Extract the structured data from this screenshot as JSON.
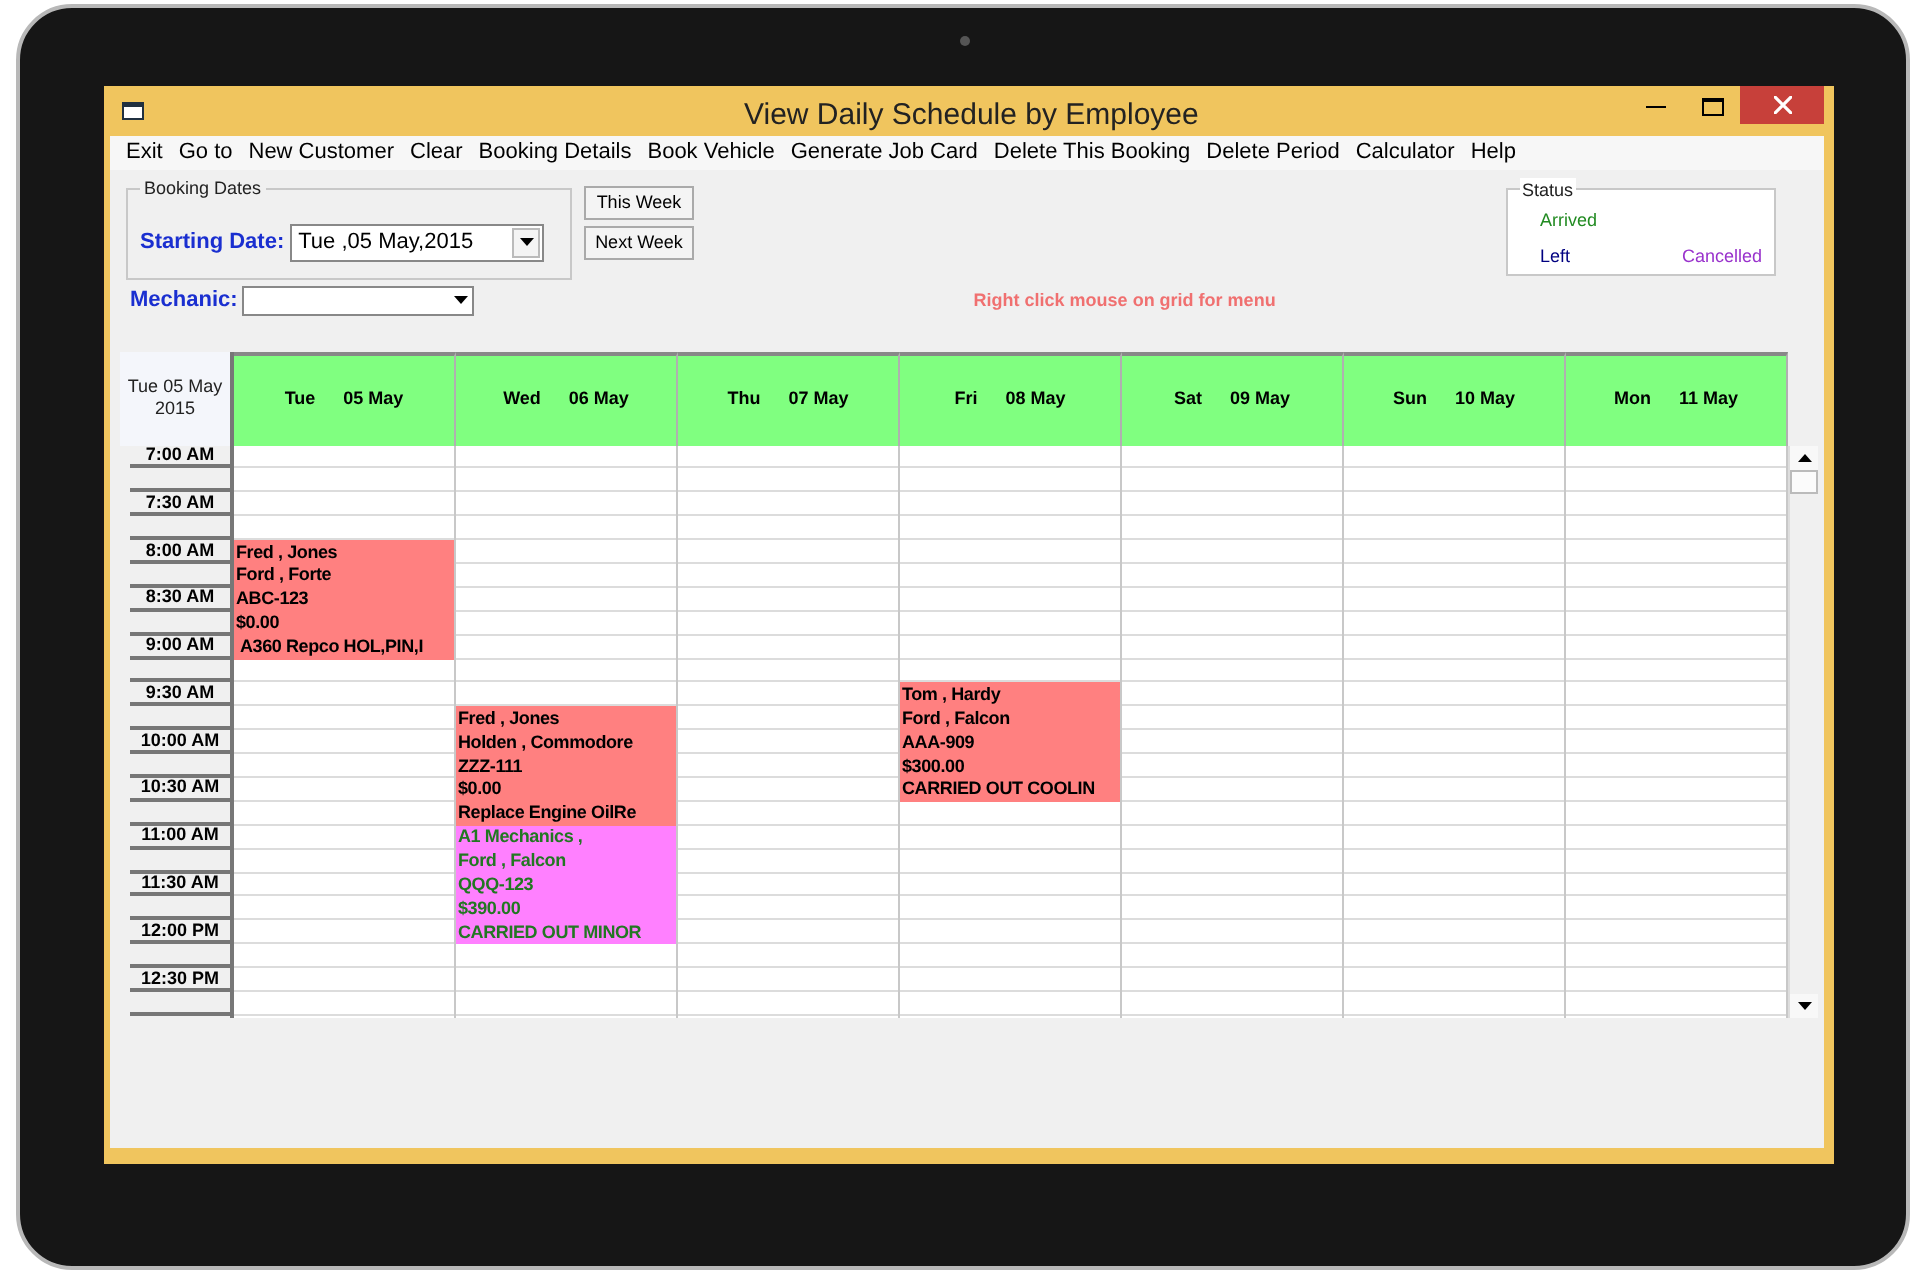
{
  "window": {
    "title": "View Daily Schedule by Employee"
  },
  "menu": [
    "Exit",
    "Go to",
    "New Customer",
    "Clear",
    "Booking Details",
    "Book Vehicle",
    "Generate Job Card",
    "Delete This Booking",
    "Delete Period",
    "Calculator",
    "Help"
  ],
  "booking_dates": {
    "title": "Booking Dates",
    "label": "Starting Date:",
    "value": "Tue ,05 May,2015"
  },
  "buttons": [
    "This Week",
    "Next Week"
  ],
  "mechanic": {
    "label": "Mechanic:"
  },
  "hint": "Right click mouse on grid for menu",
  "status": {
    "title": "Status",
    "items": [
      {
        "label": "Arrived",
        "color": "#228b22"
      },
      {
        "label": "Left",
        "color": "#000080"
      },
      {
        "label": "Cancelled",
        "color": "#9932cc"
      }
    ]
  },
  "schedule": {
    "corner": "Tue 05 May 2015",
    "times": [
      "7:00 AM",
      "7:30 AM",
      "8:00 AM",
      "8:30 AM",
      "9:00 AM",
      "9:30 AM",
      "10:00 AM",
      "10:30 AM",
      "11:00 AM",
      "11:30 AM",
      "12:00 PM",
      "12:30 PM"
    ],
    "days": [
      {
        "weekday": "Tue",
        "date": "05 May",
        "slots": [
          {
            "kind": "free"
          },
          {
            "kind": "free"
          },
          {
            "kind": "free"
          },
          {
            "kind": "free"
          },
          {
            "kind": "standard",
            "text": "Fred , Jones",
            "color": "#ff8080"
          },
          {
            "kind": "standard",
            "text": "Ford , Forte",
            "color": "#ff8080"
          },
          {
            "kind": "standard",
            "text": "ABC-123",
            "color": "#ff8080"
          },
          {
            "kind": "standard",
            "text": "$0.00",
            "color": "#ff8080"
          },
          {
            "kind": "standard",
            "text": " A360 Repco HOL,PIN,I",
            "color": "#ff8080"
          }
        ]
      },
      {
        "weekday": "Wed",
        "date": "06 May",
        "slots": [
          {
            "kind": "free"
          },
          {
            "kind": "free"
          },
          {
            "kind": "free"
          },
          {
            "kind": "free"
          },
          {
            "kind": "free"
          },
          {
            "kind": "free"
          },
          {
            "kind": "free"
          },
          {
            "kind": "free"
          },
          {
            "kind": "free"
          },
          {
            "kind": "free"
          },
          {
            "kind": "free"
          },
          {
            "kind": "standard",
            "text": "Fred , Jones",
            "color": "#ff8080"
          },
          {
            "kind": "standard",
            "text": "Holden , Commodore",
            "color": "#ff8080"
          },
          {
            "kind": "standard",
            "text": "ZZZ-111",
            "color": "#ff8080"
          },
          {
            "kind": "standard",
            "text": "$0.00",
            "color": "#ff8080"
          },
          {
            "kind": "standard",
            "text": "Replace Engine OilRe",
            "color": "#ff8080"
          },
          {
            "kind": "company",
            "text": "A1 Mechanics ,",
            "color": "#ff80ff"
          },
          {
            "kind": "company",
            "text": "Ford , Falcon",
            "color": "#ff80ff"
          },
          {
            "kind": "company",
            "text": "QQQ-123",
            "color": "#ff80ff"
          },
          {
            "kind": "company",
            "text": "$390.00",
            "color": "#ff80ff"
          },
          {
            "kind": "company",
            "text": "CARRIED OUT MINOR",
            "color": "#ff80ff"
          }
        ]
      },
      {
        "weekday": "Thu",
        "date": "07 May"
      },
      {
        "weekday": "Fri",
        "date": "08 May",
        "slots": [
          {
            "kind": "free"
          },
          {
            "kind": "free"
          },
          {
            "kind": "free"
          },
          {
            "kind": "free"
          },
          {
            "kind": "free"
          },
          {
            "kind": "free"
          },
          {
            "kind": "free"
          },
          {
            "kind": "free"
          },
          {
            "kind": "free"
          },
          {
            "kind": "free"
          },
          {
            "kind": "standard",
            "text": "Tom , Hardy",
            "color": "#ff8080"
          },
          {
            "kind": "standard",
            "text": "Ford , Falcon",
            "color": "#ff8080"
          },
          {
            "kind": "standard",
            "text": "AAA-909",
            "color": "#ff8080"
          },
          {
            "kind": "standard",
            "text": "$300.00",
            "color": "#ff8080"
          },
          {
            "kind": "standard",
            "text": "CARRIED OUT COOLIN",
            "color": "#ff8080"
          }
        ]
      },
      {
        "weekday": "Sat",
        "date": "09 May"
      },
      {
        "weekday": "Sun",
        "date": "10 May"
      },
      {
        "weekday": "Mon",
        "date": "11 May"
      }
    ]
  }
}
